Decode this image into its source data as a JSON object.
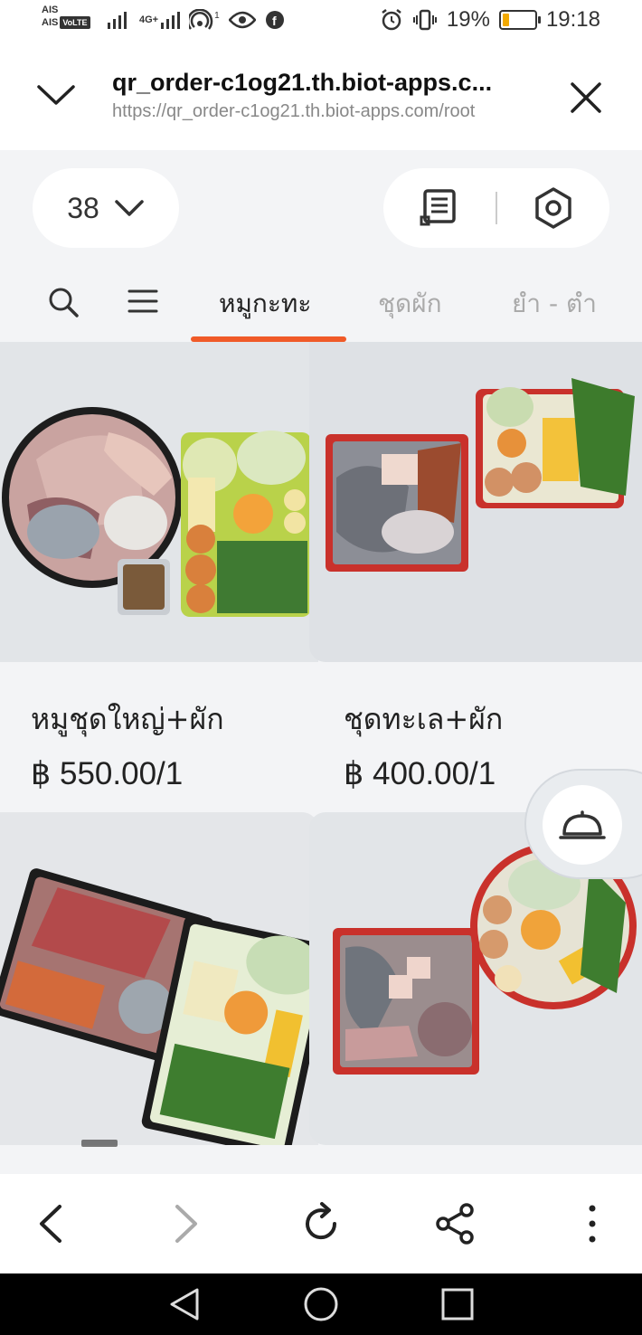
{
  "status_bar": {
    "carrier_1": "AIS",
    "carrier_2": "AIS",
    "volte": "VoLTE",
    "network": "4G+",
    "hotspot_count": "1",
    "battery_percent": "19%",
    "battery_level": 0.19,
    "time": "19:18"
  },
  "browser": {
    "title": "qr_order-c1og21.th.biot-apps.c...",
    "url": "https://qr_order-c1og21.th.biot-apps.com/root"
  },
  "header": {
    "table_number": "38"
  },
  "tabs": [
    {
      "label": "หมูกะทะ",
      "active": true
    },
    {
      "label": "ชุดผัก",
      "active": false
    },
    {
      "label": "ยำ - ตำ",
      "active": false
    }
  ],
  "products": [
    {
      "name": "หมูชุดใหญ่+ผัก",
      "price": "฿ 550.00/1",
      "image": "pork-set-photo"
    },
    {
      "name": "ชุดทะเล+ผัก",
      "price": "฿ 400.00/1",
      "image": "seafood-set-photo"
    },
    {
      "name": "",
      "price": "",
      "image": "beef-set-photo"
    },
    {
      "name": "",
      "price": "",
      "image": "mixed-set-photo"
    }
  ],
  "colors": {
    "accent": "#f05a28",
    "page_bg": "#f3f4f6"
  }
}
